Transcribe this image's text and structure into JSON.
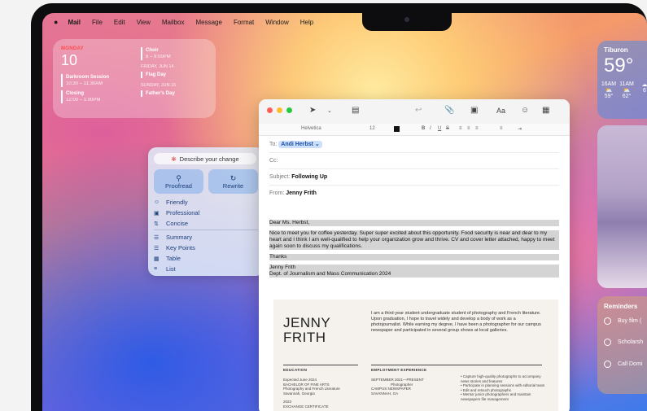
{
  "menubar": {
    "apple": "",
    "items": [
      "Mail",
      "File",
      "Edit",
      "View",
      "Mailbox",
      "Message",
      "Format",
      "Window",
      "Help"
    ]
  },
  "calendar": {
    "weekday": "MONDAY",
    "date": "10",
    "events_left": [
      {
        "title": "Darkroom Session",
        "time": "10:30 – 11:30AM"
      },
      {
        "title": "Closing",
        "time": "12:00 – 1:00PM"
      }
    ],
    "events_right": [
      {
        "title": "Choir",
        "time": "8 – 9:00PM"
      },
      {
        "header": "FRIDAY, JUN 14"
      },
      {
        "title": "Flag Day"
      },
      {
        "header": "SUNDAY, JUN 16"
      },
      {
        "title": "Father's Day"
      }
    ]
  },
  "weather": {
    "city": "Tiburon",
    "temp": "59°",
    "forecast": [
      {
        "time": "16AM",
        "icon": "cloud-sun-icon",
        "temp": "59°"
      },
      {
        "time": "11AM",
        "icon": "cloud-sun-icon",
        "temp": "62°"
      },
      {
        "time": "",
        "icon": "cloud-icon",
        "temp": "6"
      }
    ]
  },
  "reminders": {
    "title": "Reminders",
    "items": [
      "Buy film (",
      "Scholarsh",
      "Call Domi"
    ]
  },
  "writing_tools": {
    "describe": "Describe your change",
    "proofread": "Proofread",
    "rewrite": "Rewrite",
    "tones": [
      "Friendly",
      "Professional",
      "Concise"
    ],
    "formats": [
      "Summary",
      "Key Points",
      "Table",
      "List"
    ]
  },
  "mail": {
    "font": "Helvetica",
    "size": "12",
    "to_label": "To:",
    "to_value": "Andi Herbst",
    "cc_label": "Cc:",
    "subject_label": "Subject:",
    "subject_value": "Following Up",
    "from_label": "From:",
    "from_value": "Jenny Frith",
    "greeting": "Dear Ms. Herbst,",
    "paragraph": "Nice to meet you for coffee yesterday. Super super excited about this opportunity. Food security is near and dear to my heart and I think I am well-qualified to help your organization grow and thrive. CV and cover letter attached, happy to meet again soon to discuss my qualifications.",
    "thanks": "Thanks",
    "sig_name": "Jenny Frith",
    "sig_dept": "Dept. of Journalism and Mass Communication 2024"
  },
  "resume": {
    "name_line1": "JENNY",
    "name_line2": "FRITH",
    "bio": "I am a third-year student undergraduate student of photography and French literature. Upon graduation, I hope to travel widely and develop a body of work as a photojournalist. While earning my degree, I have been a photographer for our campus newspaper and participated in several group shows at local galleries.",
    "education_head": "EDUCATION",
    "education_lines": [
      "Expected June 2024",
      "BACHELOR OF FINE ARTS",
      "Photography and French Literature",
      "Savannah, Georgia",
      "",
      "2023",
      "EXCHANGE CERTIFICATE"
    ],
    "employment_head": "EMPLOYMENT EXPERIENCE",
    "employment_lines": [
      "SEPTEMBER 2021—PRESENT",
      "Photographer",
      "CAMPUS NEWSPAPER",
      "SAVANNAH, GA"
    ],
    "bullets": [
      "Capture high-quality photographs to accompany news stories and features",
      "Participate in planning sessions with editorial team",
      "Edit and retouch photographs",
      "Mentor junior photographers and maintain newspapers file management"
    ]
  }
}
